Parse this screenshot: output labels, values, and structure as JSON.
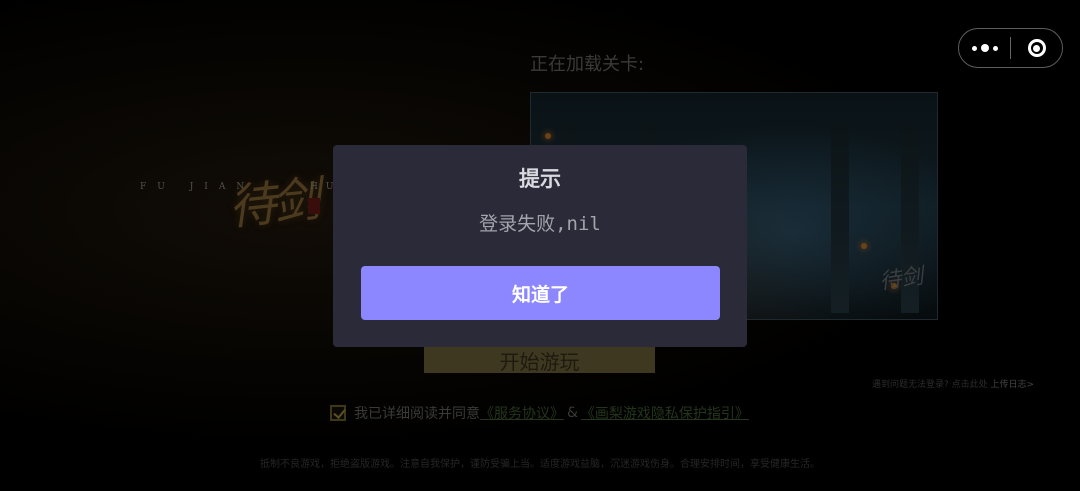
{
  "background": {
    "logo": {
      "sub_left": "FU JIAN",
      "title": "待剑",
      "sub_right": "HU"
    },
    "loading_label": "正在加载关卡:",
    "start_button_label": "开始游玩",
    "upload_log_hint": "遇到问题无法登录? 点击此处",
    "upload_log_link": "上传日志>",
    "agreement": {
      "checked": true,
      "text": "我已详细阅读并同意",
      "service_link": "《服务协议》",
      "amp": "&",
      "privacy_link": "《画梨游戏隐私保护指引》"
    },
    "health_notice": "抵制不良游戏，拒绝盗版游戏。注意自我保护，谨防受骗上当。适度游戏益脑，沉迷游戏伤身。合理安排时间，享受健康生活。",
    "image_watermark": "待剑"
  },
  "capsule": {
    "more_icon": "more-dots-icon",
    "close_icon": "target-close-icon"
  },
  "modal": {
    "title": "提示",
    "message": "登录失败,nil",
    "confirm_label": "知道了",
    "accent_color": "#8c87ff",
    "background_color": "#2b2a39"
  }
}
